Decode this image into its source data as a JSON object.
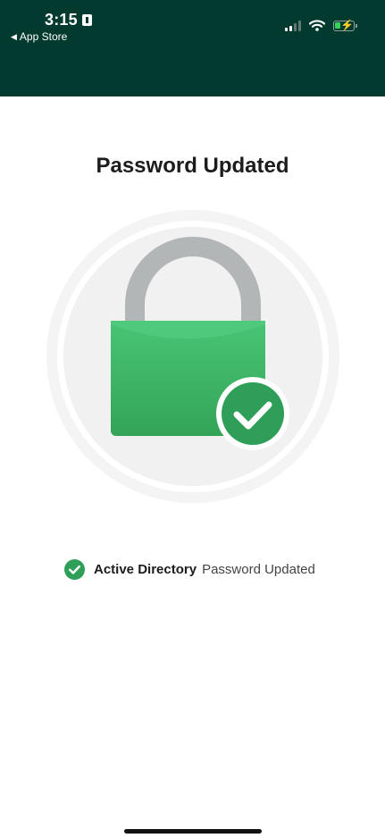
{
  "status_bar": {
    "time": "3:15",
    "back_app_label": "App Store"
  },
  "page": {
    "title": "Password Updated"
  },
  "result": {
    "system": "Active Directory",
    "message": "Password Updated"
  },
  "icons": {
    "illustration": "lock-with-check-icon",
    "status": "check-circle-icon"
  },
  "colors": {
    "header_bg": "#023a30",
    "success_green": "#2e9e58",
    "lock_green": "#3fb865",
    "shackle_gray": "#b3b6b7",
    "circle_bg": "#f1f1f1"
  }
}
